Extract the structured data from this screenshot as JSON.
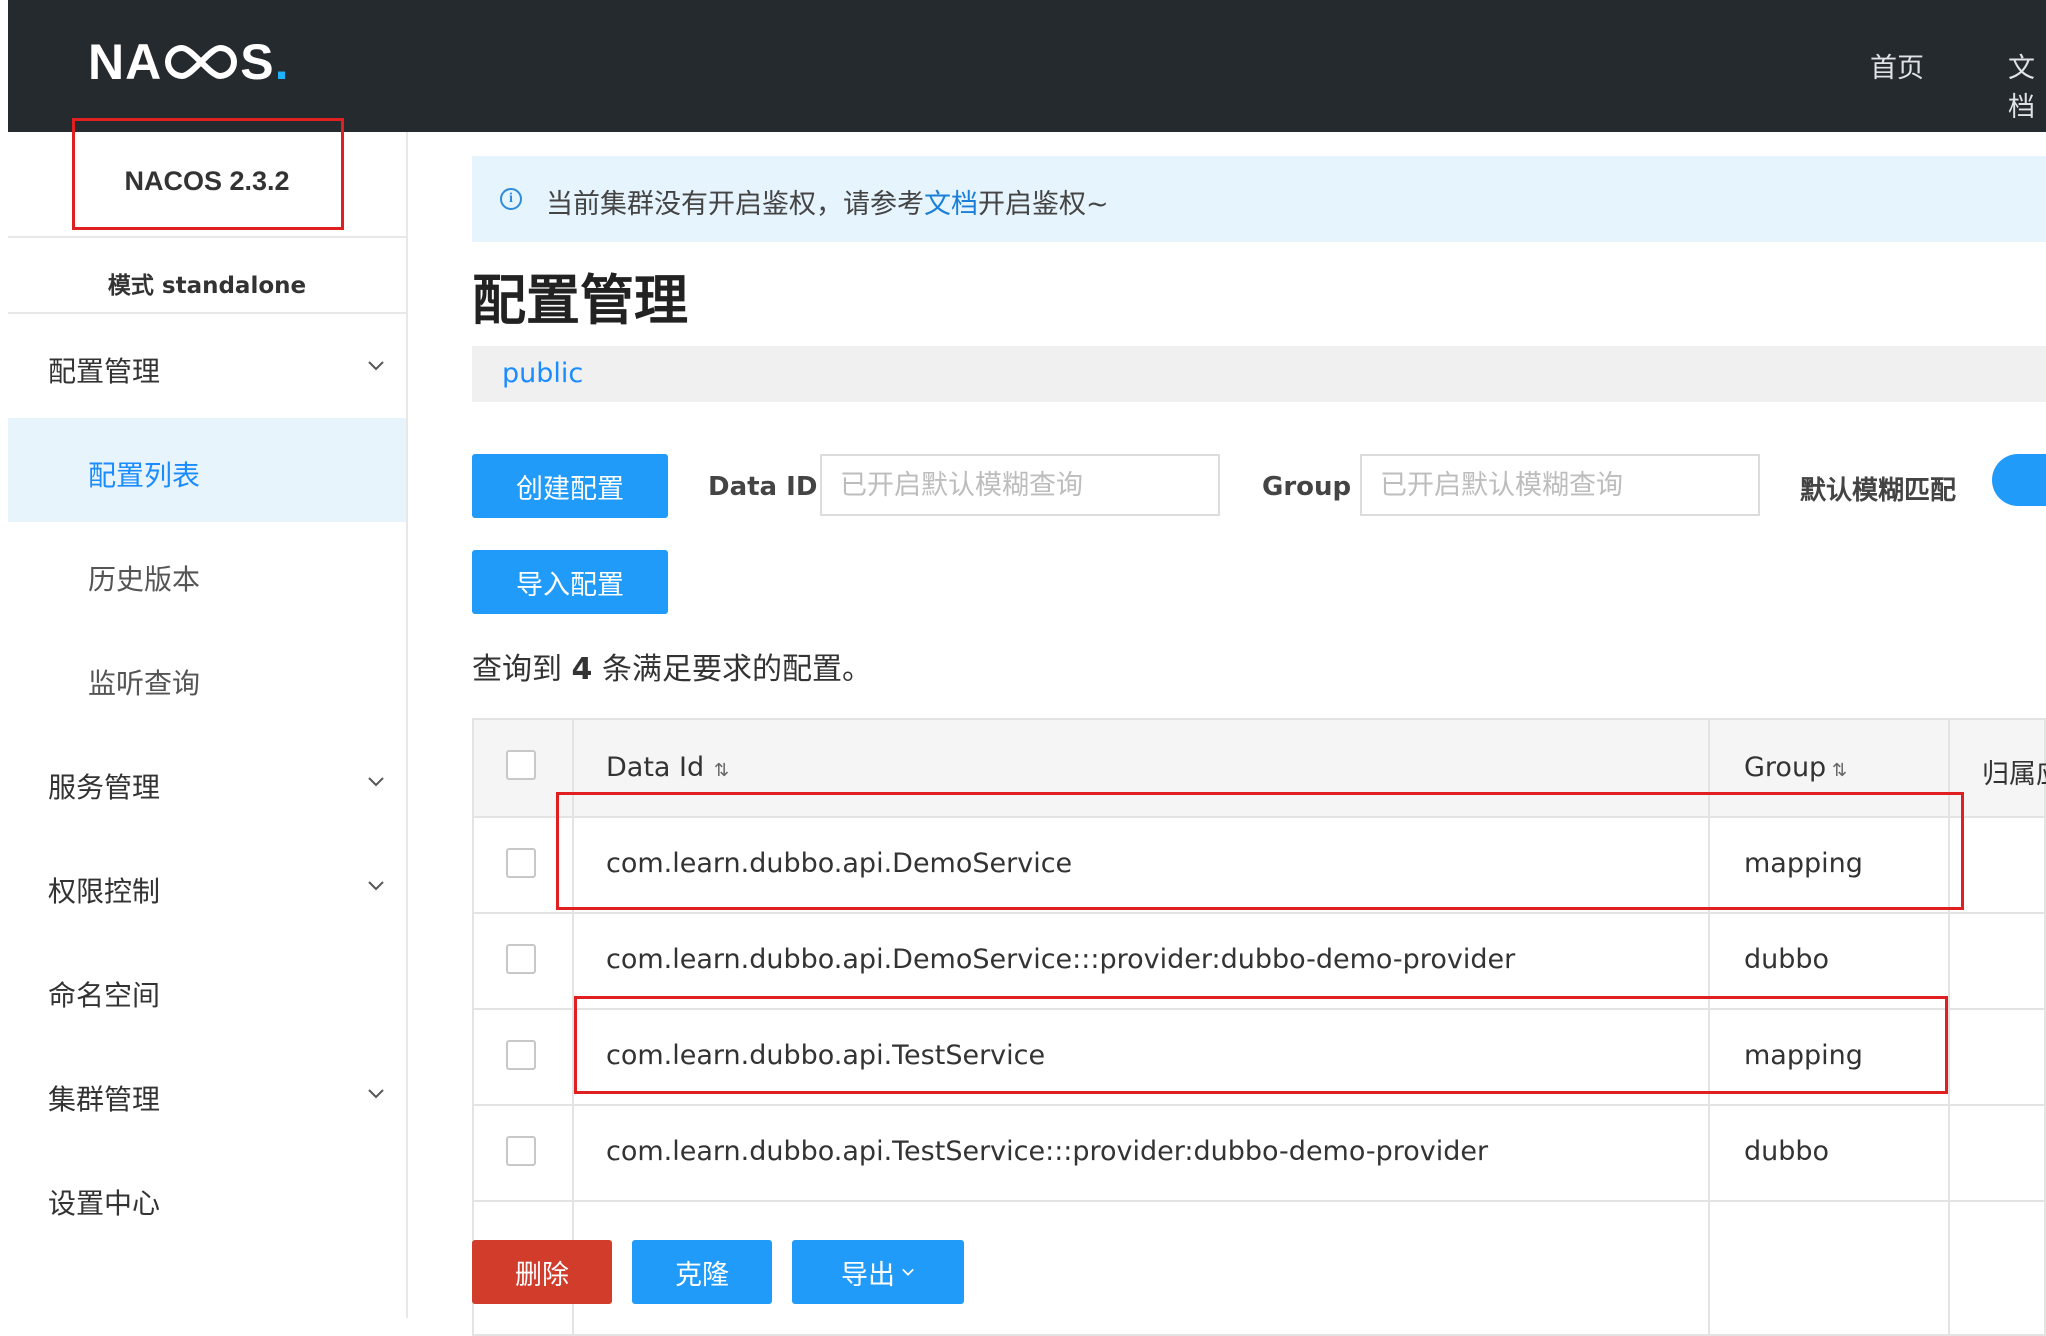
{
  "app": {
    "brand": "NACOS",
    "version": "NACOS 2.3.2",
    "mode": "模式 standalone"
  },
  "topnav": {
    "home": "首页",
    "docs": "文档"
  },
  "sidebar": {
    "items": [
      {
        "label": "配置管理"
      },
      {
        "label": "配置列表"
      },
      {
        "label": "历史版本"
      },
      {
        "label": "监听查询"
      },
      {
        "label": "服务管理"
      },
      {
        "label": "权限控制"
      },
      {
        "label": "命名空间"
      },
      {
        "label": "集群管理"
      },
      {
        "label": "设置中心"
      }
    ]
  },
  "notice": {
    "prefix": "当前集群没有开启鉴权，请参考",
    "link": "文档",
    "suffix": "开启鉴权~"
  },
  "page": {
    "title": "配置管理",
    "namespace": "public"
  },
  "toolbar": {
    "create_label": "创建配置",
    "import_label": "导入配置",
    "dataid_label": "Data ID",
    "dataid_placeholder": "已开启默认模糊查询",
    "group_label": "Group",
    "group_placeholder": "已开启默认模糊查询",
    "fuzzy_label": "默认模糊匹配"
  },
  "result": {
    "prefix": "查询到",
    "count": "4",
    "suffix": "条满足要求的配置。"
  },
  "table": {
    "headers": {
      "dataid": "Data Id",
      "group": "Group",
      "tenant": "归属应用"
    },
    "rows": [
      {
        "dataid": "com.learn.dubbo.api.DemoService",
        "group": "mapping"
      },
      {
        "dataid": "com.learn.dubbo.api.DemoService:::provider:dubbo-demo-provider",
        "group": "dubbo"
      },
      {
        "dataid": "com.learn.dubbo.api.TestService",
        "group": "mapping"
      },
      {
        "dataid": "com.learn.dubbo.api.TestService:::provider:dubbo-demo-provider",
        "group": "dubbo"
      }
    ]
  },
  "footer": {
    "delete_label": "删除",
    "clone_label": "克隆",
    "export_label": "导出"
  },
  "colors": {
    "topbar": "#252a2f",
    "primary": "#209bfa",
    "danger": "#d23c2b",
    "highlight": "#e02020"
  }
}
